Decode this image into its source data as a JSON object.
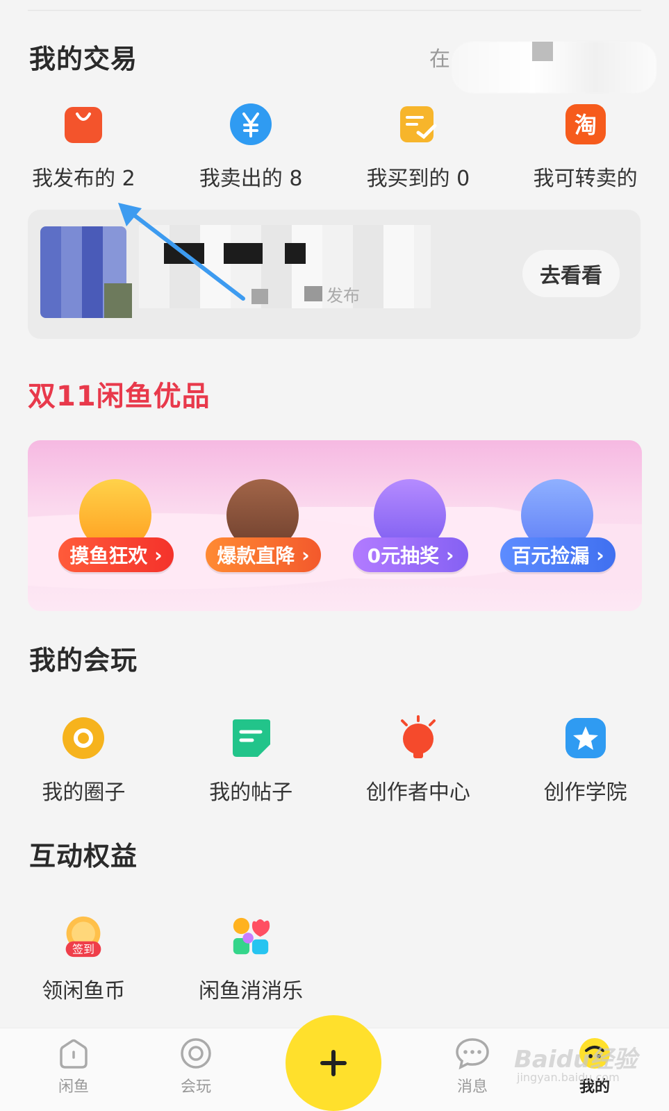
{
  "trade": {
    "title": "我的交易",
    "status_text": "在",
    "items": [
      {
        "label": "我发布的 2",
        "icon": "shopping-bag-icon",
        "color": "#f3542c"
      },
      {
        "label": "我卖出的 8",
        "icon": "yen-coin-icon",
        "color": "#2f9bf2"
      },
      {
        "label": "我买到的 0",
        "icon": "receipt-check-icon",
        "color": "#f7b52b"
      },
      {
        "label": "我可转卖的",
        "icon": "taobao-icon",
        "color": "#f65b1c"
      }
    ],
    "card": {
      "subtext": "发布",
      "button": "去看看"
    }
  },
  "promo": {
    "title": "双11闲鱼优品",
    "items": [
      {
        "label": "摸鱼狂欢"
      },
      {
        "label": "爆款直降"
      },
      {
        "label": "0元抽奖"
      },
      {
        "label": "百元捡漏"
      }
    ]
  },
  "play": {
    "title": "我的会玩",
    "items": [
      {
        "label": "我的圈子",
        "icon": "circle-ring-icon",
        "color": "#f6b31d"
      },
      {
        "label": "我的帖子",
        "icon": "post-note-icon",
        "color": "#22c48a"
      },
      {
        "label": "创作者中心",
        "icon": "lightbulb-icon",
        "color": "#f54a2c"
      },
      {
        "label": "创作学院",
        "icon": "star-badge-icon",
        "color": "#2f9bf2"
      }
    ]
  },
  "rights": {
    "title": "互动权益",
    "items": [
      {
        "label": "领闲鱼币",
        "icon": "sign-in-coin-icon",
        "badge": "签到"
      },
      {
        "label": "闲鱼消消乐",
        "icon": "puzzle-game-icon"
      }
    ]
  },
  "nav": {
    "items": [
      {
        "label": "闲鱼",
        "icon": "home-icon"
      },
      {
        "label": "会玩",
        "icon": "ring-icon"
      },
      {
        "label": "消息",
        "icon": "chat-icon"
      },
      {
        "label": "我的",
        "icon": "profile-face-icon"
      }
    ],
    "publish_icon": "plus-icon"
  },
  "watermark": {
    "main": "Baidu经验",
    "sub": "jingyan.baidu.com"
  }
}
